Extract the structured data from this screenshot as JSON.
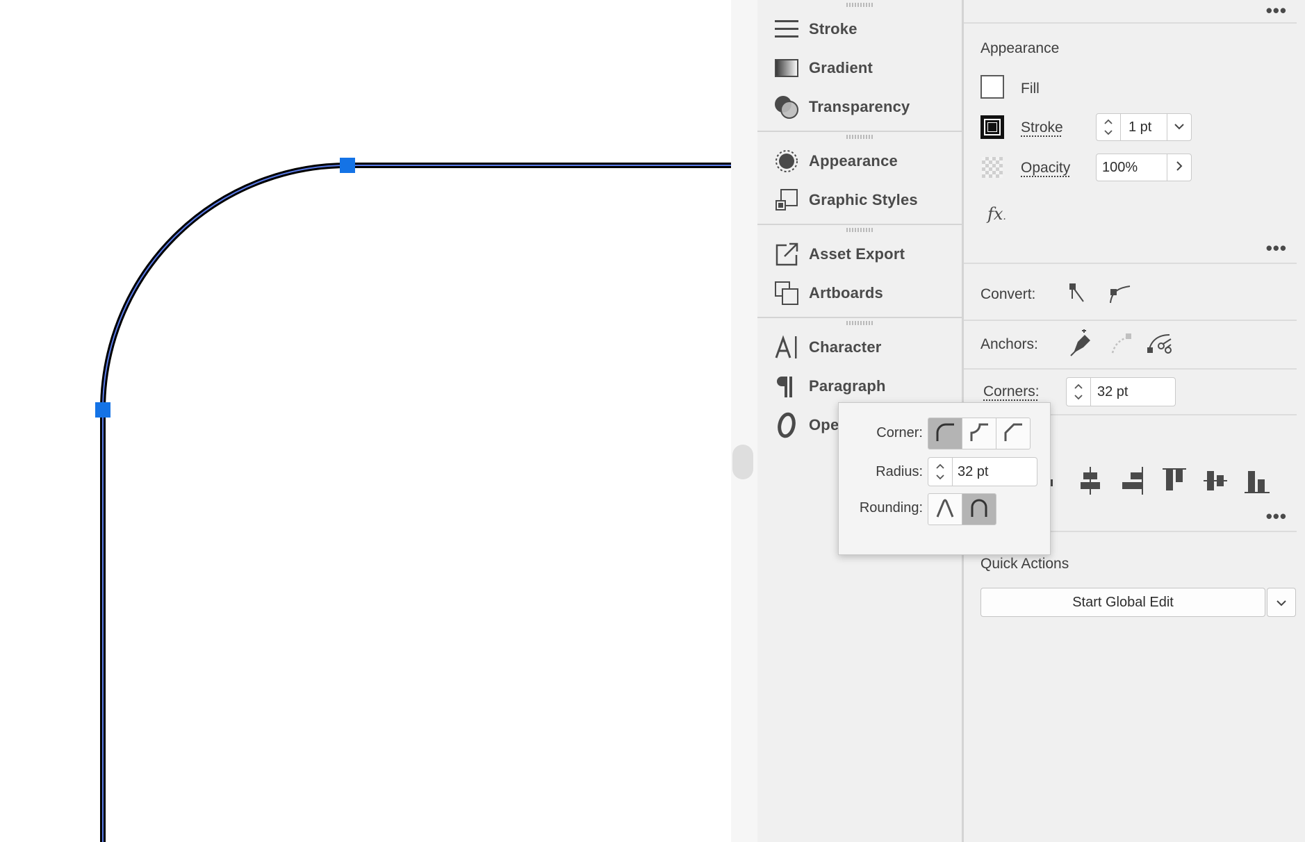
{
  "panels": {
    "groups": [
      [
        "Stroke",
        "Gradient",
        "Transparency"
      ],
      [
        "Appearance",
        "Graphic Styles"
      ],
      [
        "Asset Export",
        "Artboards"
      ],
      [
        "Character",
        "Paragraph",
        "Ope"
      ]
    ]
  },
  "properties": {
    "appearance": {
      "title": "Appearance",
      "fill_label": "Fill",
      "stroke_label": "Stroke",
      "stroke_weight": "1 pt",
      "opacity_label": "Opacity",
      "opacity_value": "100%",
      "fx_label": "fx"
    },
    "anchor": {
      "convert_label": "Convert:",
      "anchors_label": "Anchors:",
      "corners_label": "Corners:",
      "corners_value": "32 pt"
    },
    "quick_actions": {
      "title": "Quick Actions",
      "global_edit_label": "Start Global Edit"
    }
  },
  "corner_popup": {
    "corner_label": "Corner:",
    "radius_label": "Radius:",
    "radius_value": "32 pt",
    "rounding_label": "Rounding:",
    "corner_types": [
      "round",
      "inverted-round",
      "chamfer"
    ],
    "selected_corner_type": "round",
    "rounding_types": [
      "relative",
      "absolute"
    ],
    "selected_rounding_type": "absolute"
  },
  "colors": {
    "selection_blue": "#1473e6",
    "path_stroke": "#000000",
    "panel_bg": "#f0f0f0"
  }
}
